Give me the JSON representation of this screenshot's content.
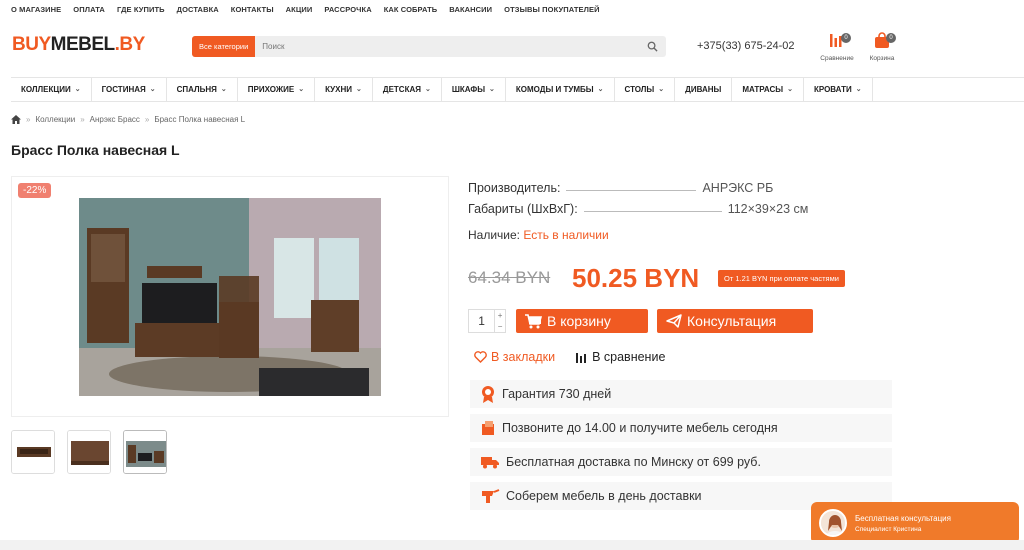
{
  "top_nav": [
    "О МАГАЗИНЕ",
    "ОПЛАТА",
    "ГДЕ КУПИТЬ",
    "ДОСТАВКА",
    "КОНТАКТЫ",
    "АКЦИИ",
    "РАССРОЧКА",
    "КАК СОБРАТЬ",
    "ВАКАНСИИ",
    "ОТЗЫВЫ ПОКУПАТЕЛЕЙ"
  ],
  "logo": {
    "part1": "BUY",
    "part2": "MEBEL",
    "part3": ".BY"
  },
  "search": {
    "category_button": "Все категории",
    "placeholder": "Поиск"
  },
  "phone": "+375(33) 675-24-02",
  "compare": {
    "label": "Сравнение",
    "count": "0"
  },
  "cart": {
    "label": "Корзина",
    "count": "0"
  },
  "main_menu": [
    "КОЛЛЕКЦИИ",
    "ГОСТИНАЯ",
    "СПАЛЬНЯ",
    "ПРИХОЖИЕ",
    "КУХНИ",
    "ДЕТСКАЯ",
    "ШКАФЫ",
    "КОМОДЫ И ТУМБЫ",
    "СТОЛЫ",
    "ДИВАНЫ",
    "МАТРАСЫ",
    "КРОВАТИ"
  ],
  "breadcrumbs": [
    "Коллекции",
    "Анрэкс Брасс",
    "Брасс Полка навесная L"
  ],
  "product": {
    "title": "Брасс Полка навесная L",
    "discount": "-22%",
    "manufacturer_label": "Производитель:",
    "manufacturer": "АНРЭКС РБ",
    "dims_label": "Габариты (ШхВхГ):",
    "dims": "112×39×23 см",
    "avail_label": "Наличие:",
    "avail": "Есть в наличии",
    "old_price": "64.34 BYN",
    "price": "50.25 BYN",
    "installment": "От 1.21 BYN при оплате частями",
    "qty": "1",
    "qty_plus": "+",
    "qty_minus": "−",
    "cart_button": "В корзину",
    "consult_button": "Консультация",
    "bookmark": "В закладки",
    "compare": "В сравнение"
  },
  "features": [
    "Гарантия 730 дней",
    "Позвоните до 14.00 и получите мебель сегодня",
    "Бесплатная доставка по Минску от 699 руб.",
    "Соберем мебель в день доставки"
  ],
  "consult_widget": {
    "title": "Бесплатная консультация",
    "subtitle": "Специалист Кристина"
  },
  "colors": {
    "accent": "#f05a22"
  }
}
